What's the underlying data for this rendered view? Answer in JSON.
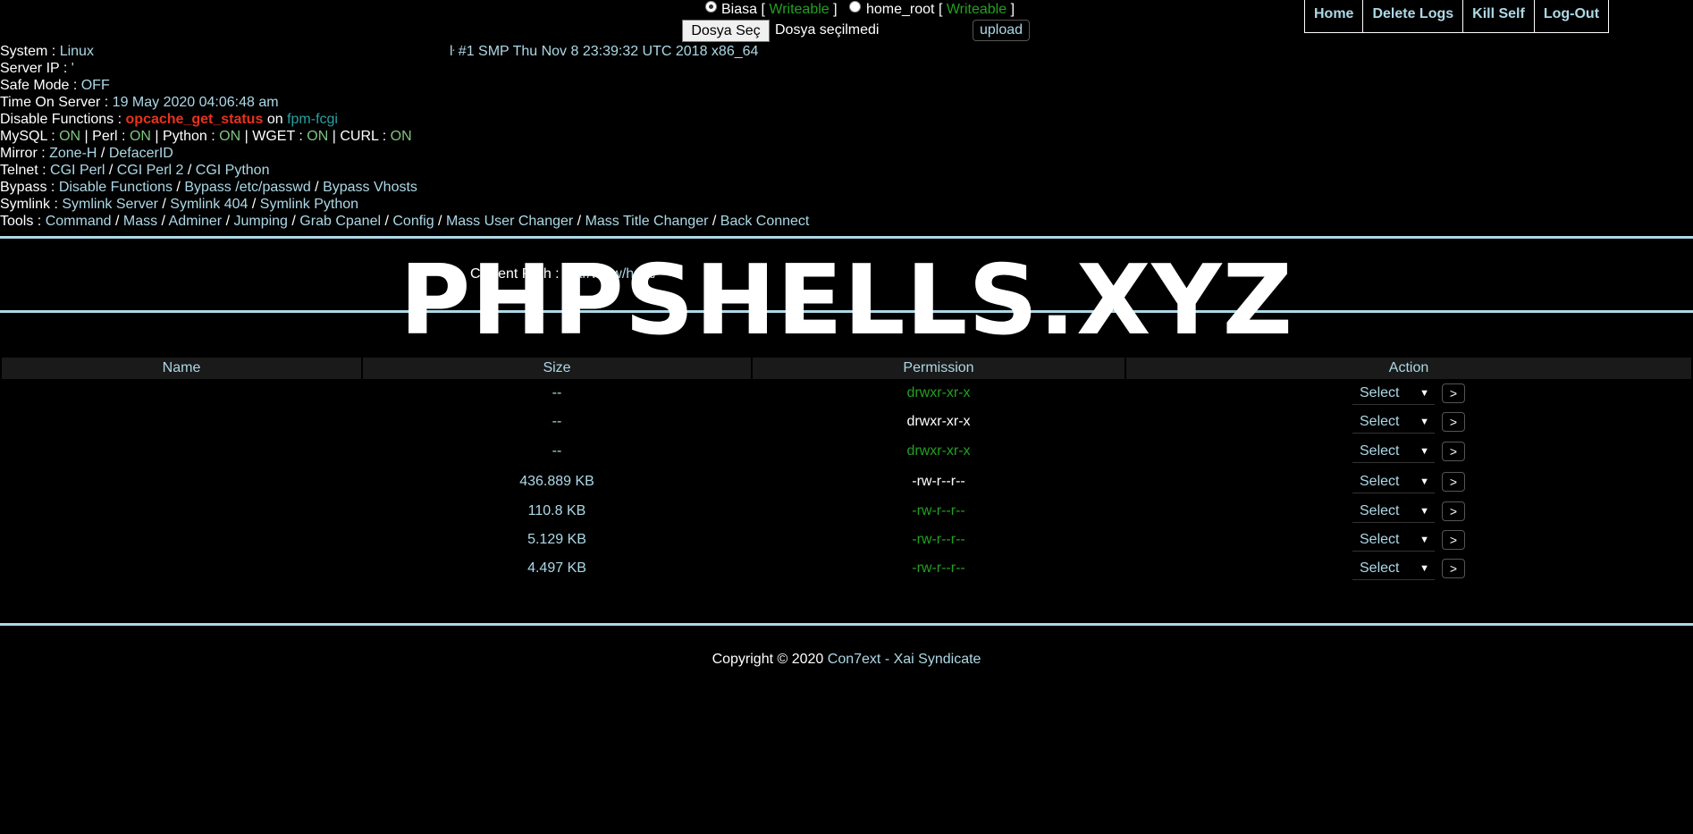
{
  "upload": {
    "radio1_label": "Biasa [",
    "radio1_status": "Writeable",
    "radio1_close": "]",
    "radio2_label": "home_root [",
    "radio2_status": "Writeable",
    "radio2_close": "]",
    "file_button": "Dosya Seç",
    "file_status": "Dosya seçilmedi",
    "upload_button": "upload"
  },
  "nav": {
    "home": "Home",
    "delete_logs": "Delete Logs",
    "kill_self": "Kill Self",
    "logout": "Log-Out"
  },
  "info": {
    "system_label": "System :",
    "system_value": "Linux",
    "uname": "ŀ #1 SMP Thu Nov 8 23:39:32 UTC 2018 x86_64",
    "server_ip_label": "Server IP :",
    "server_ip_value": "'",
    "safe_mode_label": "Safe Mode :",
    "safe_mode_value": "OFF",
    "time_label": "Time On Server :",
    "time_value": "19 May 2020 04:06:48 am",
    "disable_label": "Disable Functions :",
    "disable_value": "opcache_get_status",
    "disable_on": "on",
    "disable_sapi": "fpm-fcgi",
    "mysql_label": "MySQL :",
    "mysql_value": "ON",
    "perl_label": "| Perl :",
    "perl_value": "ON",
    "python_label": "| Python :",
    "python_value": "ON",
    "wget_label": "| WGET :",
    "wget_value": "ON",
    "curl_label": "| CURL :",
    "curl_value": "ON",
    "mirror_label": "Mirror :",
    "mirror_links": [
      "Zone-H",
      "DefacerID"
    ],
    "telnet_label": "Telnet :",
    "telnet_links": [
      "CGI Perl",
      "CGI Perl 2",
      "CGI Python"
    ],
    "bypass_label": "Bypass :",
    "bypass_links": [
      "Disable Functions",
      "Bypass /etc/passwd",
      "Bypass Vhosts"
    ],
    "symlink_label": "Symlink :",
    "symlink_links": [
      "Symlink Server",
      "Symlink 404",
      "Symlink Python"
    ],
    "tools_label": "Tools :",
    "tools_links": [
      "Command",
      "Mass",
      "Adminer",
      "Jumping",
      "Grab Cpanel",
      "Config",
      "Mass User Changer",
      "Mass Title Changer",
      "Back Connect"
    ],
    "separator": "/"
  },
  "path": {
    "label": "Current Path :",
    "value": "/var/www/host/"
  },
  "banner": "PHPSHELLS.XYZ",
  "table": {
    "headers": [
      "Name",
      "Size",
      "Permission",
      "Action"
    ],
    "rows": [
      {
        "name": "",
        "size": "--",
        "perm": "drwxr-xr-x",
        "perm_color": "#22a022"
      },
      {
        "name": "",
        "size": "--",
        "perm": "drwxr-xr-x",
        "perm_color": "#ffffff"
      },
      {
        "name": "",
        "size": "--",
        "perm": "drwxr-xr-x",
        "perm_color": "#22a022"
      },
      {
        "name": "",
        "size": "436.889 KB",
        "perm": "-rw-r--r--",
        "perm_color": "#ffffff"
      },
      {
        "name": "",
        "size": "110.8 KB",
        "perm": "-rw-r--r--",
        "perm_color": "#22a022"
      },
      {
        "name": "",
        "size": "5.129 KB",
        "perm": "-rw-r--r--",
        "perm_color": "#22a022"
      },
      {
        "name": "",
        "size": "4.497 KB",
        "perm": "-rw-r--r--",
        "perm_color": "#22a022"
      }
    ],
    "select_label": "Select",
    "go_label": ">"
  },
  "footer": {
    "prefix": "Copyright © 2020",
    "author": "Con7ext",
    "dash": "-",
    "team": "Xai Syndicate"
  },
  "colors": {
    "accent": "#add8e6",
    "on_green": "#7fc47f",
    "writeable_green": "#22a022",
    "disabled_red": "#e8321c"
  }
}
